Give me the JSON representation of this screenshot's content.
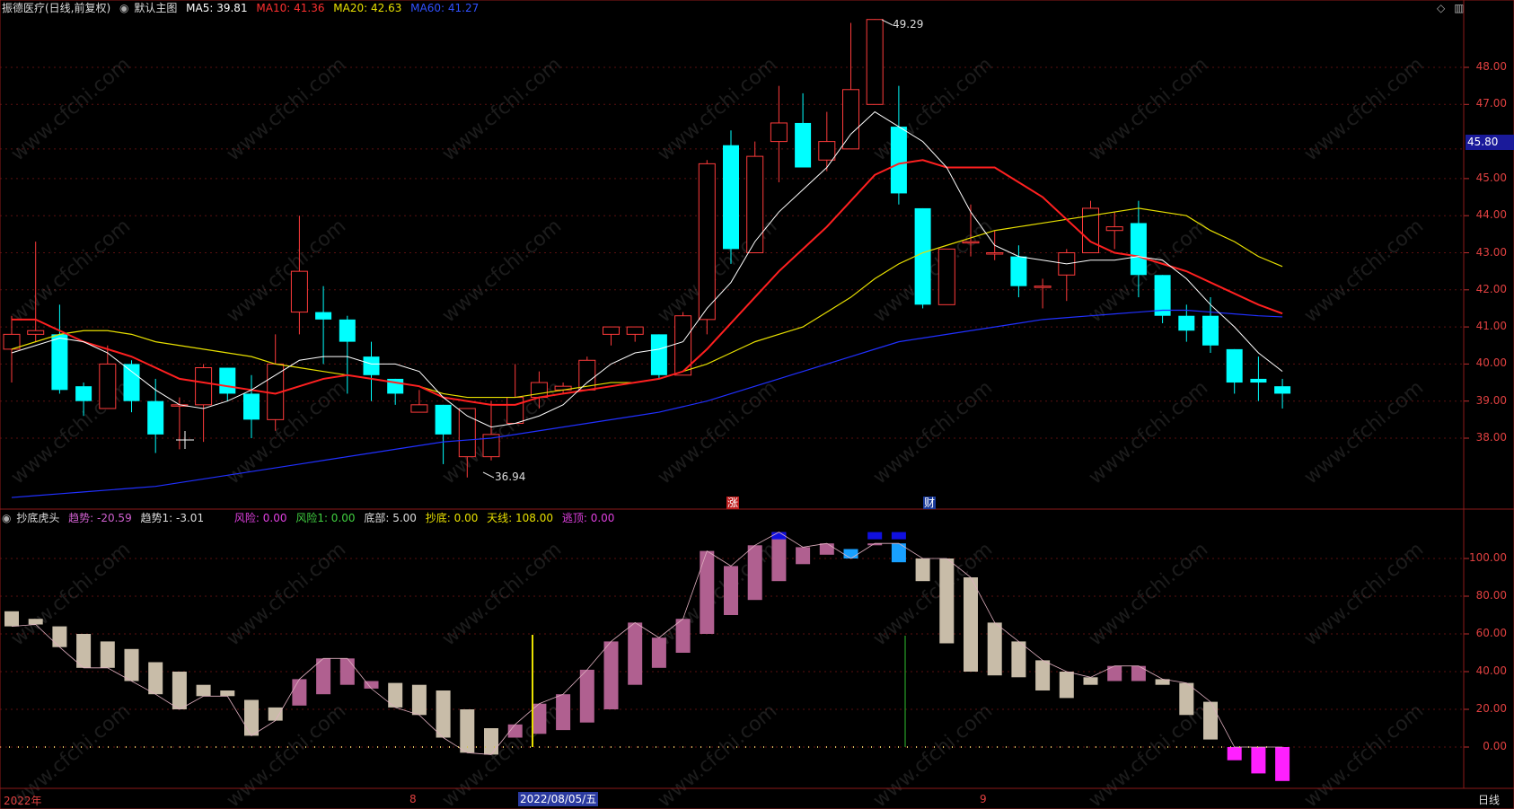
{
  "header": {
    "stock": "振德医疗(日线,前复权)",
    "chart_name": "默认主图",
    "ma5": "MA5: 39.81",
    "ma10": "MA10: 41.36",
    "ma20": "MA20: 42.63",
    "ma60": "MA60: 41.27"
  },
  "indicator_header": {
    "name": "抄底虎头",
    "items": [
      "趋势: -20.59",
      "趋势1: -3.01",
      "风险: 0.00",
      "风险1: 0.00",
      "底部: 5.00",
      "抄底: 0.00",
      "天线: 108.00",
      "逃顶: 0.00"
    ]
  },
  "price_axis": [
    "48.00",
    "47.00",
    "45.00",
    "44.00",
    "43.00",
    "42.00",
    "41.00",
    "40.00",
    "39.00",
    "38.00"
  ],
  "current_price": "45.80",
  "ind_axis": [
    "100.00",
    "80.00",
    "60.00",
    "40.00",
    "20.00",
    "0.00"
  ],
  "high_label": "49.29",
  "low_label": "36.94",
  "events": [
    "涨",
    "财"
  ],
  "bottom_bar": {
    "year": "2022年",
    "aug": "8",
    "date": "2022/08/05/五",
    "sep": "9",
    "period": "日线"
  },
  "watermark": "www.cfchi.com",
  "colors": {
    "up": "#ff3b3b",
    "down": "#00ffff",
    "ma5": "#ffffff",
    "ma10": "#ff2020",
    "ma20": "#e8e000",
    "ma60": "#2030ff"
  },
  "chart_data": {
    "type": "candlestick",
    "candles": [
      [
        40.4,
        40.8,
        39.5,
        41.3
      ],
      [
        40.8,
        40.9,
        40.6,
        43.3
      ],
      [
        40.8,
        39.3,
        39.2,
        41.6
      ],
      [
        39.4,
        39.0,
        38.6,
        39.5
      ],
      [
        38.8,
        40.0,
        38.8,
        40.5
      ],
      [
        40.0,
        39.0,
        38.7,
        40.1
      ],
      [
        39.0,
        38.1,
        37.6,
        39.6
      ],
      [
        38.9,
        38.9,
        37.7,
        39.1
      ],
      [
        38.9,
        39.9,
        37.9,
        40.0
      ],
      [
        39.9,
        39.2,
        39.0,
        39.9
      ],
      [
        39.2,
        38.5,
        38.0,
        39.7
      ],
      [
        38.5,
        40.0,
        38.2,
        40.8
      ],
      [
        41.4,
        42.5,
        40.8,
        44.0
      ],
      [
        41.4,
        41.2,
        40.0,
        42.1
      ],
      [
        41.2,
        40.6,
        39.2,
        41.3
      ],
      [
        40.2,
        39.7,
        39.0,
        40.6
      ],
      [
        39.6,
        39.2,
        38.9,
        39.6
      ],
      [
        38.7,
        38.9,
        38.7,
        39.3
      ],
      [
        38.9,
        38.1,
        37.3,
        38.9
      ],
      [
        37.5,
        38.8,
        36.94,
        37.6
      ],
      [
        37.5,
        38.1,
        37.4,
        39.0
      ],
      [
        38.4,
        39.1,
        38.5,
        40.0
      ],
      [
        39.1,
        39.5,
        38.8,
        39.8
      ],
      [
        39.3,
        39.4,
        39.2,
        39.5
      ],
      [
        39.3,
        40.1,
        39.3,
        40.2
      ],
      [
        40.8,
        41.0,
        40.5,
        41.0
      ],
      [
        40.8,
        41.0,
        40.6,
        41.0
      ],
      [
        40.8,
        39.7,
        39.6,
        40.8
      ],
      [
        39.7,
        41.3,
        39.7,
        41.4
      ],
      [
        41.2,
        45.4,
        40.8,
        45.5
      ],
      [
        45.9,
        43.1,
        42.7,
        46.3
      ],
      [
        43.0,
        45.6,
        43.0,
        46.0
      ],
      [
        46.0,
        46.5,
        44.9,
        47.5
      ],
      [
        46.5,
        45.3,
        45.3,
        47.3
      ],
      [
        45.5,
        46.0,
        45.2,
        46.8
      ],
      [
        45.8,
        47.4,
        45.8,
        49.2
      ],
      [
        47.0,
        49.29,
        47.0,
        49.3
      ],
      [
        46.4,
        44.6,
        44.3,
        47.5
      ],
      [
        44.2,
        41.6,
        41.5,
        44.2
      ],
      [
        41.6,
        43.1,
        41.6,
        43.0
      ],
      [
        43.3,
        43.3,
        42.9,
        44.3
      ],
      [
        43.0,
        43.0,
        42.8,
        43.6
      ],
      [
        42.9,
        42.1,
        41.8,
        43.2
      ],
      [
        42.1,
        42.1,
        41.5,
        42.3
      ],
      [
        42.4,
        43.0,
        41.7,
        43.1
      ],
      [
        43.0,
        44.2,
        43.0,
        44.4
      ],
      [
        43.6,
        43.7,
        43.1,
        44.1
      ],
      [
        43.8,
        42.4,
        41.8,
        44.4
      ],
      [
        42.4,
        41.3,
        41.1,
        42.4
      ],
      [
        41.3,
        40.9,
        40.6,
        41.6
      ],
      [
        41.3,
        40.5,
        40.3,
        41.8
      ],
      [
        40.4,
        39.5,
        39.2,
        40.4
      ],
      [
        39.6,
        39.5,
        39.0,
        40.2
      ],
      [
        39.4,
        39.2,
        38.8,
        39.6
      ]
    ],
    "ma5": [
      40.3,
      40.5,
      40.7,
      40.6,
      40.3,
      39.8,
      39.3,
      38.9,
      38.8,
      39.0,
      39.3,
      39.7,
      40.1,
      40.2,
      40.2,
      40.0,
      40.0,
      39.8,
      39.1,
      38.6,
      38.3,
      38.4,
      38.6,
      38.9,
      39.5,
      40.0,
      40.3,
      40.4,
      40.6,
      41.5,
      42.2,
      43.3,
      44.1,
      44.7,
      45.3,
      46.2,
      46.8,
      46.4,
      46.0,
      45.3,
      44.1,
      43.2,
      42.9,
      42.8,
      42.7,
      42.8,
      42.8,
      42.9,
      42.8,
      42.3,
      41.6,
      41.0,
      40.3,
      39.8
    ],
    "ma10": [
      41.2,
      41.2,
      40.9,
      40.6,
      40.4,
      40.2,
      39.9,
      39.6,
      39.5,
      39.4,
      39.3,
      39.2,
      39.4,
      39.6,
      39.7,
      39.6,
      39.5,
      39.4,
      39.1,
      39.0,
      38.9,
      38.9,
      39.1,
      39.2,
      39.3,
      39.4,
      39.5,
      39.6,
      39.8,
      40.4,
      41.1,
      41.8,
      42.5,
      43.1,
      43.7,
      44.4,
      45.1,
      45.4,
      45.5,
      45.3,
      45.3,
      45.3,
      44.9,
      44.5,
      43.9,
      43.3,
      43.0,
      42.9,
      42.7,
      42.5,
      42.2,
      41.9,
      41.6,
      41.36
    ],
    "ma20": [
      40.4,
      40.6,
      40.8,
      40.9,
      40.9,
      40.8,
      40.6,
      40.5,
      40.4,
      40.3,
      40.2,
      40.0,
      39.9,
      39.8,
      39.7,
      39.6,
      39.5,
      39.4,
      39.2,
      39.1,
      39.1,
      39.1,
      39.2,
      39.3,
      39.4,
      39.5,
      39.5,
      39.6,
      39.8,
      40.0,
      40.3,
      40.6,
      40.8,
      41.0,
      41.4,
      41.8,
      42.3,
      42.7,
      43.0,
      43.2,
      43.4,
      43.6,
      43.7,
      43.8,
      43.9,
      44.0,
      44.1,
      44.2,
      44.1,
      44.0,
      43.6,
      43.3,
      42.9,
      42.63
    ],
    "ma60": [
      36.4,
      36.45,
      36.5,
      36.55,
      36.6,
      36.65,
      36.7,
      36.8,
      36.9,
      37.0,
      37.1,
      37.2,
      37.3,
      37.4,
      37.5,
      37.6,
      37.7,
      37.8,
      37.9,
      37.95,
      38.0,
      38.1,
      38.2,
      38.3,
      38.4,
      38.5,
      38.6,
      38.7,
      38.85,
      39.0,
      39.2,
      39.4,
      39.6,
      39.8,
      40.0,
      40.2,
      40.4,
      40.6,
      40.7,
      40.8,
      40.9,
      41.0,
      41.1,
      41.2,
      41.25,
      41.3,
      41.35,
      41.4,
      41.45,
      41.45,
      41.4,
      41.35,
      41.3,
      41.27
    ],
    "indicator": {
      "name": "抄底虎头",
      "bars": [
        [
          72,
          64,
          "beige"
        ],
        [
          68,
          65,
          "beige"
        ],
        [
          64,
          53,
          "beige"
        ],
        [
          60,
          42,
          "beige"
        ],
        [
          56,
          42,
          "beige"
        ],
        [
          52,
          35,
          "beige"
        ],
        [
          45,
          28,
          "beige"
        ],
        [
          40,
          20,
          "beige"
        ],
        [
          33,
          27,
          "beige"
        ],
        [
          30,
          27,
          "beige"
        ],
        [
          25,
          6,
          "beige"
        ],
        [
          21,
          14,
          "beige"
        ],
        [
          22,
          36,
          "pink"
        ],
        [
          28,
          47,
          "pink"
        ],
        [
          33,
          47,
          "pink"
        ],
        [
          35,
          31,
          "pink"
        ],
        [
          34,
          21,
          "beige"
        ],
        [
          33,
          17,
          "beige"
        ],
        [
          30,
          5,
          "beige"
        ],
        [
          20,
          -3,
          "beige"
        ],
        [
          10,
          -4,
          "beige"
        ],
        [
          5,
          12,
          "pink"
        ],
        [
          7,
          23,
          "pink"
        ],
        [
          9,
          28,
          "pink"
        ],
        [
          13,
          41,
          "pink"
        ],
        [
          20,
          56,
          "pink"
        ],
        [
          33,
          66,
          "pink"
        ],
        [
          42,
          58,
          "pink"
        ],
        [
          50,
          68,
          "pink"
        ],
        [
          60,
          104,
          "pink"
        ],
        [
          70,
          96,
          "pink"
        ],
        [
          78,
          107,
          "pink"
        ],
        [
          88,
          114,
          "pink"
        ],
        [
          97,
          106,
          "pink"
        ],
        [
          102,
          108,
          "pink"
        ],
        [
          105,
          100,
          "cyan"
        ],
        [
          107,
          108,
          "pink"
        ],
        [
          98,
          108,
          "cyan"
        ],
        [
          88,
          100,
          "beige"
        ],
        [
          55,
          100,
          "beige"
        ],
        [
          40,
          90,
          "beige"
        ],
        [
          38,
          66,
          "beige"
        ],
        [
          37,
          56,
          "beige"
        ],
        [
          30,
          46,
          "beige"
        ],
        [
          26,
          40,
          "beige"
        ],
        [
          33,
          37,
          "beige"
        ],
        [
          35,
          43,
          "pink"
        ],
        [
          35,
          43,
          "pink"
        ],
        [
          33,
          36,
          "beige"
        ],
        [
          17,
          34,
          "beige"
        ],
        [
          4,
          24,
          "beige"
        ],
        [
          -7,
          0,
          "magenta"
        ],
        [
          -14,
          0,
          "magenta"
        ],
        [
          -18,
          0,
          "magenta"
        ]
      ]
    }
  }
}
